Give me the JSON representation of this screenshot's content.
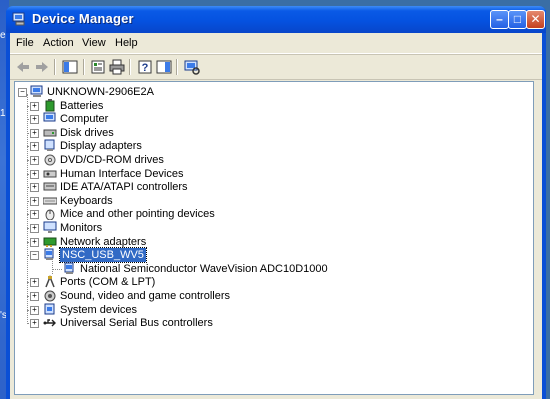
{
  "window": {
    "title": "Device Manager"
  },
  "menu": [
    "File",
    "Action",
    "View",
    "Help"
  ],
  "toolbar": [
    "back-arrow-icon",
    "forward-arrow-icon",
    "show-hide-tree-icon",
    "properties-icon",
    "print-icon",
    "help-icon",
    "show-hide-action-pane-icon",
    "scan-hardware-icon"
  ],
  "tree": {
    "root": "UNKNOWN-2906E2A",
    "items": [
      {
        "label": "Batteries",
        "icon": "battery-icon",
        "expanded": false
      },
      {
        "label": "Computer",
        "icon": "computer-icon",
        "expanded": false
      },
      {
        "label": "Disk drives",
        "icon": "disk-drive-icon",
        "expanded": false
      },
      {
        "label": "Display adapters",
        "icon": "display-adapter-icon",
        "expanded": false
      },
      {
        "label": "DVD/CD-ROM drives",
        "icon": "cdrom-icon",
        "expanded": false
      },
      {
        "label": "Human Interface Devices",
        "icon": "hid-icon",
        "expanded": false
      },
      {
        "label": "IDE ATA/ATAPI controllers",
        "icon": "ide-controller-icon",
        "expanded": false
      },
      {
        "label": "Keyboards",
        "icon": "keyboard-icon",
        "expanded": false
      },
      {
        "label": "Mice and other pointing devices",
        "icon": "mouse-icon",
        "expanded": false
      },
      {
        "label": "Monitors",
        "icon": "monitor-icon",
        "expanded": false
      },
      {
        "label": "Network adapters",
        "icon": "network-adapter-icon",
        "expanded": false
      },
      {
        "label": "NSC_USB_WV5",
        "icon": "usb-device-icon",
        "expanded": true,
        "selected": true,
        "children": [
          {
            "label": "National Semiconductor WaveVision ADC10D1000",
            "icon": "usb-device-icon"
          }
        ]
      },
      {
        "label": "Ports (COM & LPT)",
        "icon": "port-icon",
        "expanded": false
      },
      {
        "label": "Sound, video and game controllers",
        "icon": "sound-icon",
        "expanded": false
      },
      {
        "label": "System devices",
        "icon": "system-device-icon",
        "expanded": false
      },
      {
        "label": "Universal Serial Bus controllers",
        "icon": "usb-controller-icon",
        "expanded": false
      }
    ]
  },
  "colors": {
    "selection": "#316ac5",
    "titlebar": "#0552e0",
    "client": "#ece9d8"
  }
}
